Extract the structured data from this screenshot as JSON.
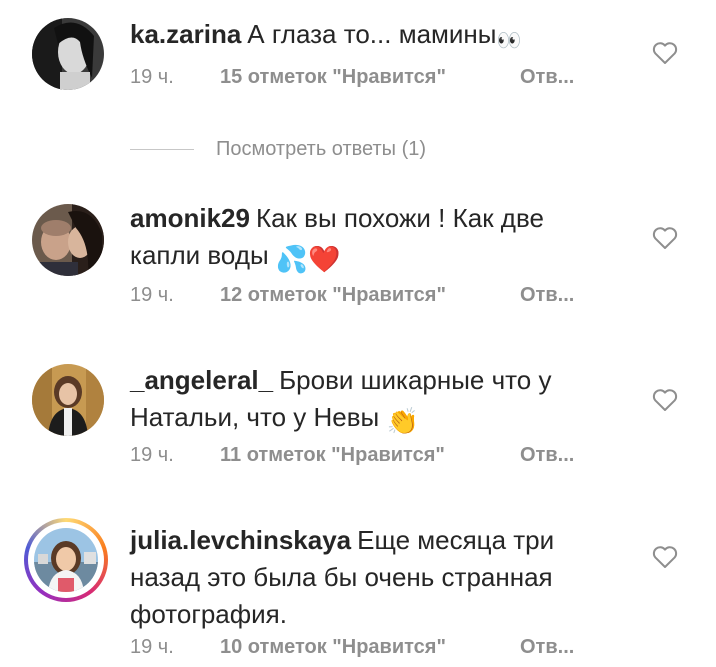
{
  "comments": [
    {
      "username": "ka.zarina",
      "text": "А глаза то... мамины",
      "emoji": "👀",
      "time": "19 ч.",
      "likes": "15 отметок \"Нравится\"",
      "reply": "Отв..."
    },
    {
      "username": "amonik29",
      "text": "Как вы похожи ! Как две капли воды",
      "emoji": "💦❤️",
      "time": "19 ч.",
      "likes": "12 отметок \"Нравится\"",
      "reply": "Отв..."
    },
    {
      "username": "_angeleral_",
      "text": "Брови шикарные что у Натальи, что у Невы",
      "emoji": "👏",
      "time": "19 ч.",
      "likes": "11 отметок \"Нравится\"",
      "reply": "Отв..."
    },
    {
      "username": "julia.levchinskaya",
      "text": "Еще месяца три назад это была бы очень странная фотография.",
      "emoji": "",
      "time": "19 ч.",
      "likes": "10 отметок \"Нравится\"",
      "reply": "Отв..."
    }
  ],
  "view_replies": "Посмотреть ответы (1)",
  "icons": {
    "like": "heart-outline-icon",
    "avatar": "user-avatar"
  },
  "colors": {
    "text": "#262626",
    "secondary": "#8e8e8e"
  }
}
